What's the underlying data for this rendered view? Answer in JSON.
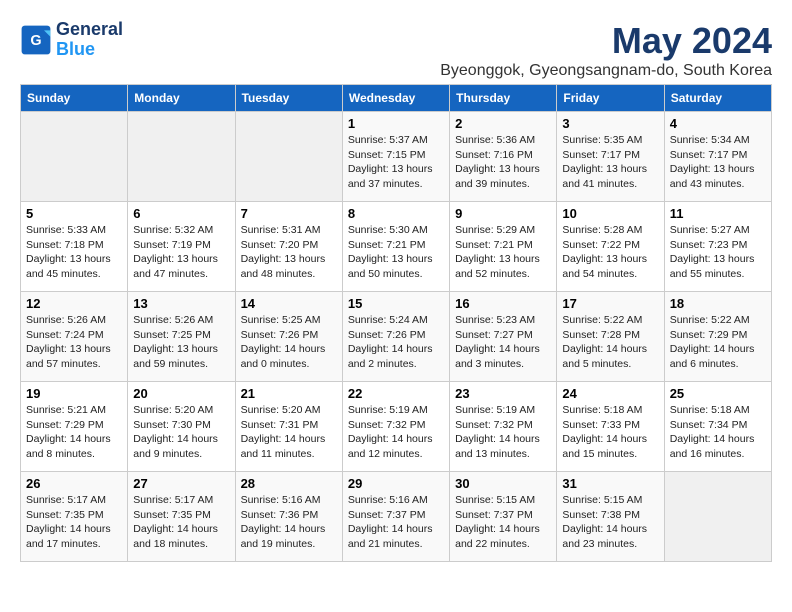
{
  "logo": {
    "line1": "General",
    "line2": "Blue"
  },
  "title": "May 2024",
  "location": "Byeonggok, Gyeongsangnam-do, South Korea",
  "weekdays": [
    "Sunday",
    "Monday",
    "Tuesday",
    "Wednesday",
    "Thursday",
    "Friday",
    "Saturday"
  ],
  "weeks": [
    [
      {
        "day": "",
        "info": ""
      },
      {
        "day": "",
        "info": ""
      },
      {
        "day": "",
        "info": ""
      },
      {
        "day": "1",
        "info": "Sunrise: 5:37 AM\nSunset: 7:15 PM\nDaylight: 13 hours and 37 minutes."
      },
      {
        "day": "2",
        "info": "Sunrise: 5:36 AM\nSunset: 7:16 PM\nDaylight: 13 hours and 39 minutes."
      },
      {
        "day": "3",
        "info": "Sunrise: 5:35 AM\nSunset: 7:17 PM\nDaylight: 13 hours and 41 minutes."
      },
      {
        "day": "4",
        "info": "Sunrise: 5:34 AM\nSunset: 7:17 PM\nDaylight: 13 hours and 43 minutes."
      }
    ],
    [
      {
        "day": "5",
        "info": "Sunrise: 5:33 AM\nSunset: 7:18 PM\nDaylight: 13 hours and 45 minutes."
      },
      {
        "day": "6",
        "info": "Sunrise: 5:32 AM\nSunset: 7:19 PM\nDaylight: 13 hours and 47 minutes."
      },
      {
        "day": "7",
        "info": "Sunrise: 5:31 AM\nSunset: 7:20 PM\nDaylight: 13 hours and 48 minutes."
      },
      {
        "day": "8",
        "info": "Sunrise: 5:30 AM\nSunset: 7:21 PM\nDaylight: 13 hours and 50 minutes."
      },
      {
        "day": "9",
        "info": "Sunrise: 5:29 AM\nSunset: 7:21 PM\nDaylight: 13 hours and 52 minutes."
      },
      {
        "day": "10",
        "info": "Sunrise: 5:28 AM\nSunset: 7:22 PM\nDaylight: 13 hours and 54 minutes."
      },
      {
        "day": "11",
        "info": "Sunrise: 5:27 AM\nSunset: 7:23 PM\nDaylight: 13 hours and 55 minutes."
      }
    ],
    [
      {
        "day": "12",
        "info": "Sunrise: 5:26 AM\nSunset: 7:24 PM\nDaylight: 13 hours and 57 minutes."
      },
      {
        "day": "13",
        "info": "Sunrise: 5:26 AM\nSunset: 7:25 PM\nDaylight: 13 hours and 59 minutes."
      },
      {
        "day": "14",
        "info": "Sunrise: 5:25 AM\nSunset: 7:26 PM\nDaylight: 14 hours and 0 minutes."
      },
      {
        "day": "15",
        "info": "Sunrise: 5:24 AM\nSunset: 7:26 PM\nDaylight: 14 hours and 2 minutes."
      },
      {
        "day": "16",
        "info": "Sunrise: 5:23 AM\nSunset: 7:27 PM\nDaylight: 14 hours and 3 minutes."
      },
      {
        "day": "17",
        "info": "Sunrise: 5:22 AM\nSunset: 7:28 PM\nDaylight: 14 hours and 5 minutes."
      },
      {
        "day": "18",
        "info": "Sunrise: 5:22 AM\nSunset: 7:29 PM\nDaylight: 14 hours and 6 minutes."
      }
    ],
    [
      {
        "day": "19",
        "info": "Sunrise: 5:21 AM\nSunset: 7:29 PM\nDaylight: 14 hours and 8 minutes."
      },
      {
        "day": "20",
        "info": "Sunrise: 5:20 AM\nSunset: 7:30 PM\nDaylight: 14 hours and 9 minutes."
      },
      {
        "day": "21",
        "info": "Sunrise: 5:20 AM\nSunset: 7:31 PM\nDaylight: 14 hours and 11 minutes."
      },
      {
        "day": "22",
        "info": "Sunrise: 5:19 AM\nSunset: 7:32 PM\nDaylight: 14 hours and 12 minutes."
      },
      {
        "day": "23",
        "info": "Sunrise: 5:19 AM\nSunset: 7:32 PM\nDaylight: 14 hours and 13 minutes."
      },
      {
        "day": "24",
        "info": "Sunrise: 5:18 AM\nSunset: 7:33 PM\nDaylight: 14 hours and 15 minutes."
      },
      {
        "day": "25",
        "info": "Sunrise: 5:18 AM\nSunset: 7:34 PM\nDaylight: 14 hours and 16 minutes."
      }
    ],
    [
      {
        "day": "26",
        "info": "Sunrise: 5:17 AM\nSunset: 7:35 PM\nDaylight: 14 hours and 17 minutes."
      },
      {
        "day": "27",
        "info": "Sunrise: 5:17 AM\nSunset: 7:35 PM\nDaylight: 14 hours and 18 minutes."
      },
      {
        "day": "28",
        "info": "Sunrise: 5:16 AM\nSunset: 7:36 PM\nDaylight: 14 hours and 19 minutes."
      },
      {
        "day": "29",
        "info": "Sunrise: 5:16 AM\nSunset: 7:37 PM\nDaylight: 14 hours and 21 minutes."
      },
      {
        "day": "30",
        "info": "Sunrise: 5:15 AM\nSunset: 7:37 PM\nDaylight: 14 hours and 22 minutes."
      },
      {
        "day": "31",
        "info": "Sunrise: 5:15 AM\nSunset: 7:38 PM\nDaylight: 14 hours and 23 minutes."
      },
      {
        "day": "",
        "info": ""
      }
    ]
  ]
}
